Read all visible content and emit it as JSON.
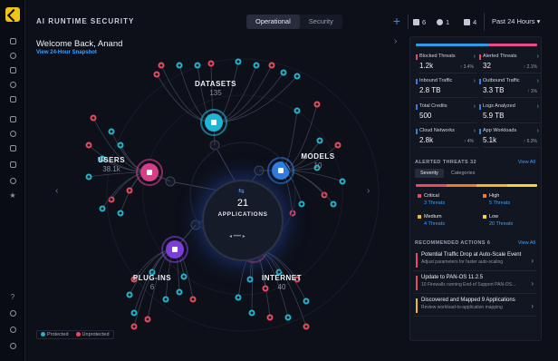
{
  "header": {
    "title": "AI RUNTIME SECURITY",
    "tabs": [
      "Operational",
      "Security"
    ],
    "plus": "+",
    "counts": [
      "6",
      "1",
      "4"
    ],
    "range": "Past 24 Hours ▾"
  },
  "welcome": {
    "title": "Welcome Back, Anand",
    "link": "View 24-Hour Snapshot"
  },
  "center": {
    "count": "21",
    "label": "APPLICATIONS"
  },
  "groups": [
    {
      "name": "DATASETS",
      "count": "135",
      "color": "#1fb6d6"
    },
    {
      "name": "MODELS",
      "count": "10",
      "color": "#2f7fe0"
    },
    {
      "name": "INTERNET",
      "count": "40",
      "color": "#e0385c"
    },
    {
      "name": "PLUG-INS",
      "count": "6",
      "color": "#7b3fd6"
    },
    {
      "name": "USERS",
      "count": "38.1k",
      "color": "#d63e8a"
    }
  ],
  "legend": {
    "protected": "Protected",
    "unprotected": "Unprotected",
    "protected_color": "#21b5cc",
    "unprotected_color": "#e84a5f"
  },
  "panel": {
    "top_cards": [
      {
        "label": "Blocked Threats",
        "value": "1.2k",
        "delta": "↑ 3.4%",
        "color": "#e84a5f"
      },
      {
        "label": "Alerted Threats",
        "value": "32",
        "delta": "↑ 2.1%",
        "color": "#e84a5f"
      },
      {
        "label": "Inbound Traffic",
        "value": "2.8 TB",
        "delta": "",
        "color": "#2f7fe0"
      },
      {
        "label": "Outbound Traffic",
        "value": "3.3 TB",
        "delta": "↑ 1%",
        "color": "#2f7fe0"
      },
      {
        "label": "Total Credits",
        "value": "500",
        "delta": "",
        "color": "#2f7fe0"
      },
      {
        "label": "Logs Analyzed",
        "value": "5.9 TB",
        "delta": "",
        "color": "#2f7fe0"
      },
      {
        "label": "Cloud Networks",
        "value": "2.8k",
        "delta": "↑ 4%",
        "color": "#2f7fe0"
      },
      {
        "label": "App Workloads",
        "value": "5.1k",
        "delta": "↑ 6.3%",
        "color": "#2f7fe0"
      }
    ],
    "alerted": {
      "title": "ALERTED THREATS",
      "count": "32",
      "view_all": "View All",
      "tabs": [
        "Severity",
        "Categories"
      ],
      "items": [
        {
          "label": "Critical",
          "threats": "3 Threats",
          "color": "#e84a5f"
        },
        {
          "label": "High",
          "threats": "5 Threats",
          "color": "#f07a2a"
        },
        {
          "label": "Medium",
          "threats": "4 Threats",
          "color": "#f1b724"
        },
        {
          "label": "Low",
          "threats": "20 Threats",
          "color": "#f5d33a"
        }
      ]
    },
    "recommended": {
      "title": "RECOMMENDED ACTIONS",
      "count": "6",
      "view_all": "View All",
      "items": [
        {
          "title": "Potential Traffic Drop at Auto-Scale Event",
          "sub": "Adjust parameters for faster auto-scaling",
          "color": "#e84a5f"
        },
        {
          "title": "Update to PAN-OS 11.2.5",
          "sub": "10 Firewalls running End-of Support PAN-OS...",
          "color": "#e84a5f"
        },
        {
          "title": "Discovered and Mapped 9 Applications",
          "sub": "Review workload-to-application mapping",
          "color": "#f1b724"
        }
      ]
    }
  }
}
